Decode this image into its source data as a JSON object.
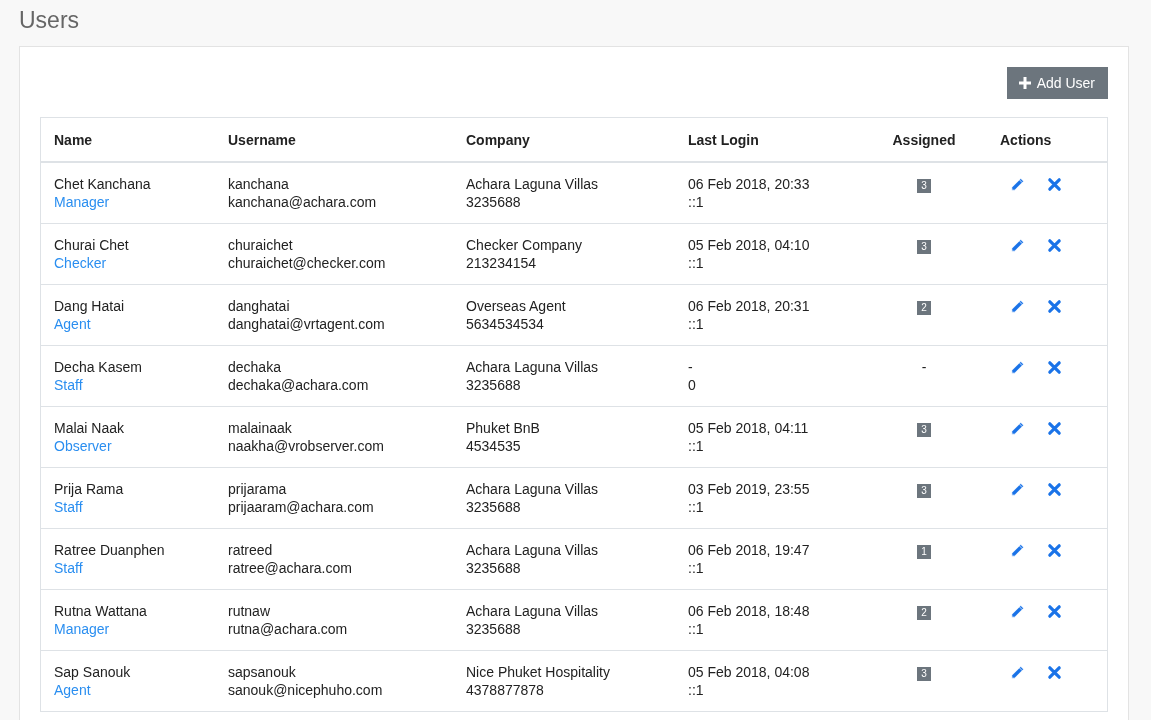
{
  "page_title": "Users",
  "add_button": {
    "label": "Add User"
  },
  "table": {
    "columns": [
      "Name",
      "Username",
      "Company",
      "Last Login",
      "Assigned",
      "Actions"
    ],
    "rows": [
      {
        "name": "Chet Kanchana",
        "role": "Manager",
        "username": "kanchana",
        "email": "kanchana@achara.com",
        "company": "Achara Laguna Villas",
        "phone": "3235688",
        "last_login": "06 Feb 2018, 20:33",
        "ip": "::1",
        "assigned": {
          "kind": "badge",
          "text": "3"
        }
      },
      {
        "name": "Churai Chet",
        "role": "Checker",
        "username": "churaichet",
        "email": "churaichet@checker.com",
        "company": "Checker Company",
        "phone": "213234154",
        "last_login": "05 Feb 2018, 04:10",
        "ip": "::1",
        "assigned": {
          "kind": "badge",
          "text": "3"
        }
      },
      {
        "name": "Dang Hatai",
        "role": "Agent",
        "username": "danghatai",
        "email": "danghatai@vrtagent.com",
        "company": "Overseas Agent",
        "phone": "5634534534",
        "last_login": "06 Feb 2018, 20:31",
        "ip": "::1",
        "assigned": {
          "kind": "badge",
          "text": "2"
        }
      },
      {
        "name": "Decha Kasem",
        "role": "Staff",
        "username": "dechaka",
        "email": "dechaka@achara.com",
        "company": "Achara Laguna Villas",
        "phone": "3235688",
        "last_login": "-",
        "ip": "0",
        "assigned": {
          "kind": "plain",
          "text": "-"
        }
      },
      {
        "name": "Malai Naak",
        "role": "Observer",
        "username": "malainaak",
        "email": "naakha@vrobserver.com",
        "company": "Phuket BnB",
        "phone": "4534535",
        "last_login": "05 Feb 2018, 04:11",
        "ip": "::1",
        "assigned": {
          "kind": "badge",
          "text": "3"
        }
      },
      {
        "name": "Prija Rama",
        "role": "Staff",
        "username": "prijarama",
        "email": "prijaaram@achara.com",
        "company": "Achara Laguna Villas",
        "phone": "3235688",
        "last_login": "03 Feb 2019, 23:55",
        "ip": "::1",
        "assigned": {
          "kind": "badge",
          "text": "3"
        }
      },
      {
        "name": "Ratree Duanphen",
        "role": "Staff",
        "username": "ratreed",
        "email": "ratree@achara.com",
        "company": "Achara Laguna Villas",
        "phone": "3235688",
        "last_login": "06 Feb 2018, 19:47",
        "ip": "::1",
        "assigned": {
          "kind": "badge",
          "text": "1"
        }
      },
      {
        "name": "Rutna Wattana",
        "role": "Manager",
        "username": "rutnaw",
        "email": "rutna@achara.com",
        "company": "Achara Laguna Villas",
        "phone": "3235688",
        "last_login": "06 Feb 2018, 18:48",
        "ip": "::1",
        "assigned": {
          "kind": "badge",
          "text": "2"
        }
      },
      {
        "name": "Sap Sanouk",
        "role": "Agent",
        "username": "sapsanouk",
        "email": "sanouk@nicephuho.com",
        "company": "Nice Phuket Hospitality",
        "phone": "4378877878",
        "last_login": "05 Feb 2018, 04:08",
        "ip": "::1",
        "assigned": {
          "kind": "badge",
          "text": "3"
        }
      }
    ]
  }
}
